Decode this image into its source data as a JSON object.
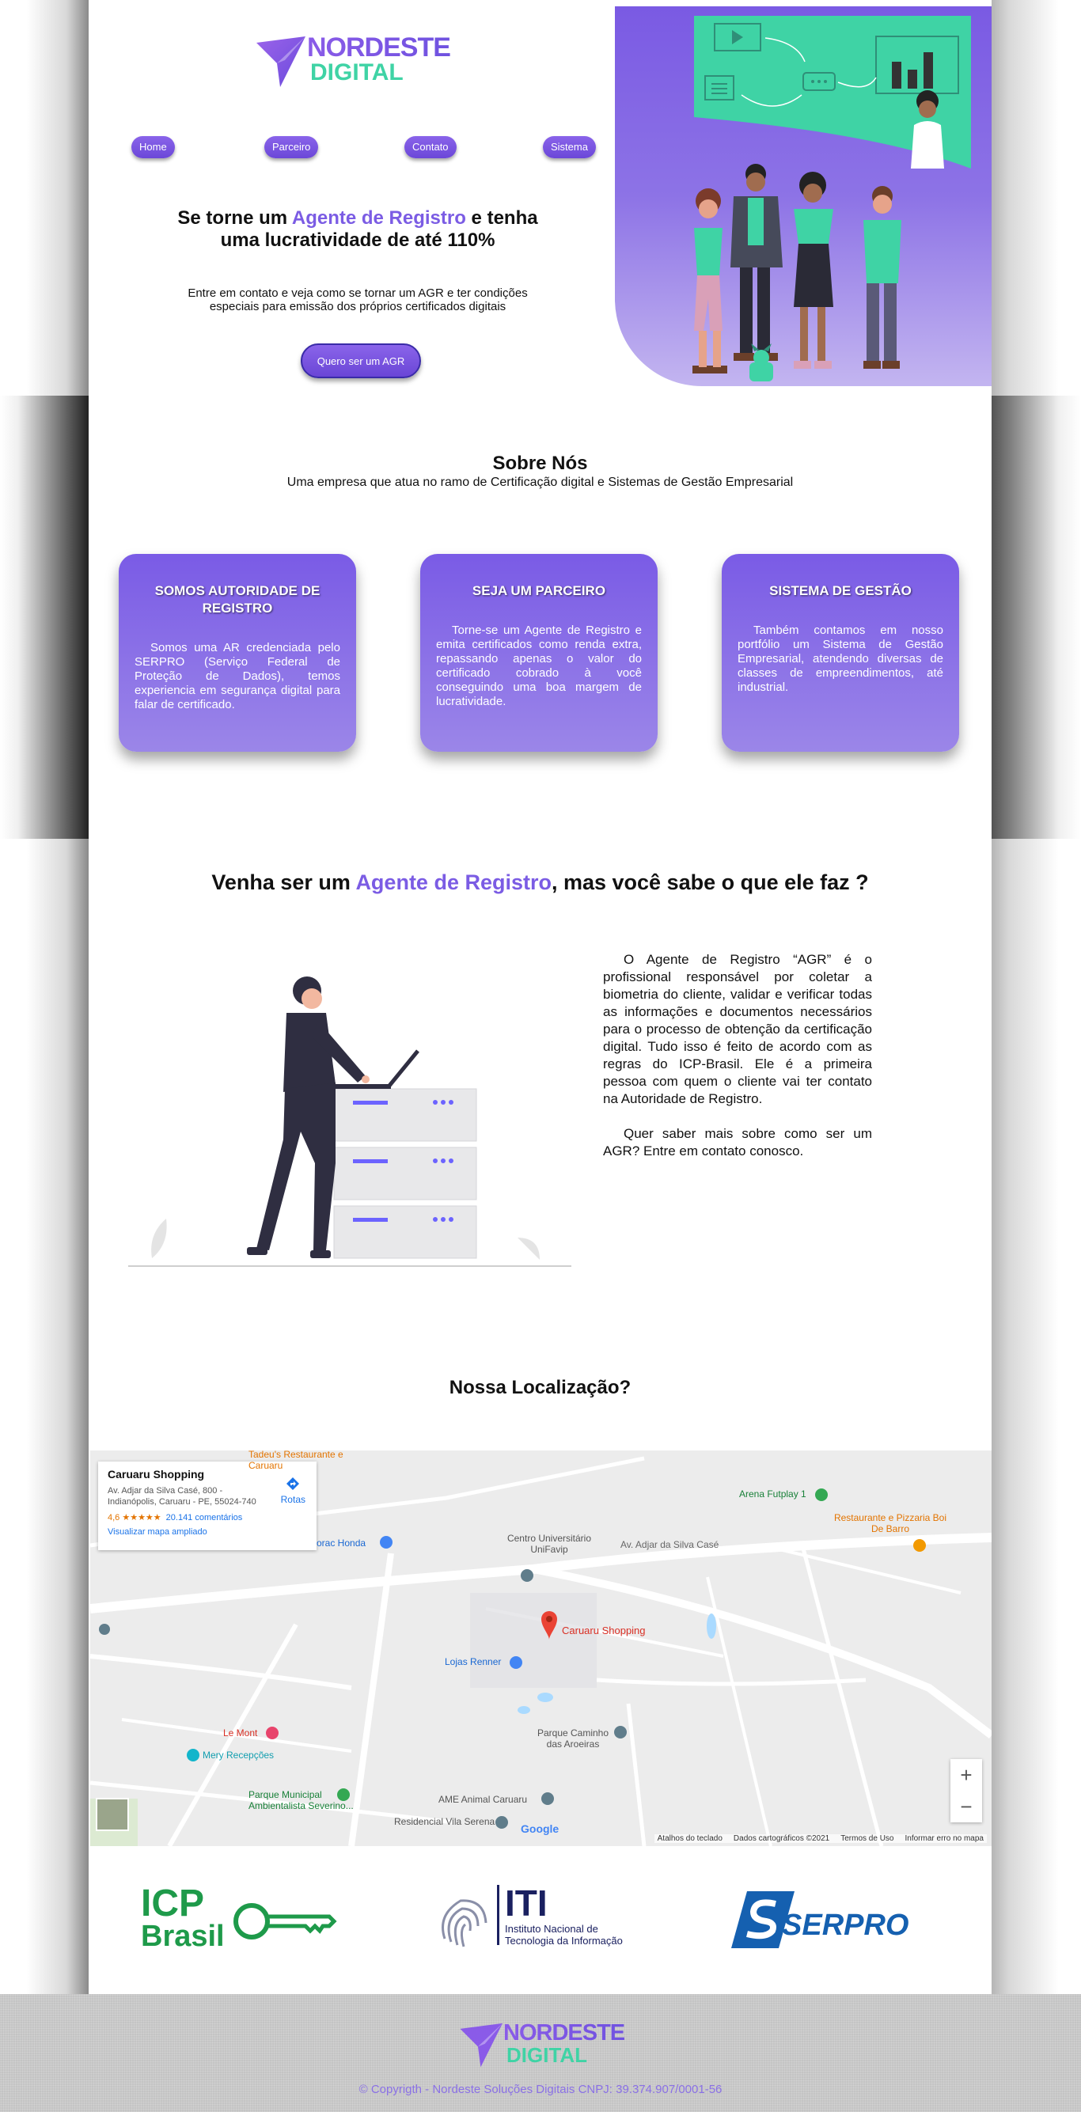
{
  "brand": {
    "line1": "NORDESTE",
    "line2": "DIGITAL"
  },
  "nav": [
    {
      "label": "Home"
    },
    {
      "label": "Parceiro"
    },
    {
      "label": "Contato"
    },
    {
      "label": "Sistema"
    }
  ],
  "hero": {
    "title_part1": "Se torne um ",
    "title_accent": "Agente de Registro",
    "title_part2": " e tenha uma lucratividade de até 110%",
    "text": "Entre em contato e veja como se tornar um AGR e ter condições especiais para emissão dos próprios certificados digitais",
    "cta": "Quero ser um AGR"
  },
  "about": {
    "title": "Sobre Nós",
    "subtitle": "Uma empresa que atua no ramo de Certificação digital e Sistemas de Gestão Empresarial",
    "cards": [
      {
        "title": "SOMOS AUTORIDADE DE REGISTRO",
        "text": "Somos uma AR credenciada pelo SERPRO (Serviço Federal de Proteção de Dados), temos experiencia em segurança digital para falar de certificado."
      },
      {
        "title": "SEJA UM PARCEIRO",
        "text": "Torne-se um Agente de Registro e emita certificados como renda extra, repassando apenas o valor do certificado cobrado à você conseguindo uma boa margem de lucratividade."
      },
      {
        "title": "SISTEMA DE GESTÃO",
        "text": "Também contamos em nosso portfólio um Sistema de Gestão Empresarial, atendendo diversas de classes de empreendimentos, até industrial."
      }
    ]
  },
  "agr": {
    "title_part1": "Venha ser um ",
    "title_accent": "Agente de Registro",
    "title_part2": ", mas você sabe o que ele faz ?",
    "p1": "O Agente de Registro “AGR” é o profissional responsável por coletar a biometria do cliente, validar e verificar todas as informações e documentos necessários para o processo de obtenção da certificação digital. Tudo isso é feito de acordo com as regras do ICP-Brasil. Ele é a primeira pessoa com quem o cliente vai ter contato na Autoridade de Registro.",
    "p2": "Quer saber mais sobre como ser um AGR? Entre em contato conosco."
  },
  "location": {
    "title": "Nossa Localização?",
    "place_name": "Caruaru Shopping",
    "address": "Av. Adjar da Silva Casé, 800 - Indianópolis, Caruaru - PE, 55024-740",
    "rating": "4,6 ★★★★★",
    "reviews": "20.141 comentários",
    "route": "Rotas",
    "view_larger": "Visualizar mapa ampliado",
    "labels": {
      "shopping": "Caruaru Shopping",
      "unifavip": "Centro Universitário UniFavip",
      "avenida": "Av. Adjar da Silva Casé",
      "arena": "Arena Futplay 1",
      "restaurante": "Restaurante e Pizzaria Boi De Barro",
      "renner": "Lojas Renner",
      "parque_caminho": "Parque Caminho das Aroeiras",
      "lemont": "Le Mont",
      "mery": "Mery Recepções",
      "parque_municipal": "Parque Municipal Ambientalista Severino...",
      "ame": "AME Animal Caruaru",
      "residencial": "Residencial Vila Serena",
      "honda": "orac Honda",
      "tadeu": "Tadeu's Restaurante e Caruaru",
      "google": "Google"
    },
    "footer": [
      "Atalhos do teclado",
      "Dados cartográficos ©2021",
      "Termos de Uso",
      "Informar erro no mapa"
    ]
  },
  "partners": {
    "icp_line1": "ICP",
    "icp_line2": "Brasil",
    "iti": "ITI",
    "iti_sub1": "Instituto Nacional de",
    "iti_sub2": "Tecnologia da Informação",
    "serpro": "SERPRO"
  },
  "footer": {
    "copyright": "© Copyrigth - Nordeste Soluções Digitais CNPJ: 39.374.907/0001-56"
  },
  "colors": {
    "accent": "#7b5ce4",
    "green": "#3fd3a5",
    "icp_green": "#1e9a4a",
    "serpro_blue": "#1560b0"
  }
}
